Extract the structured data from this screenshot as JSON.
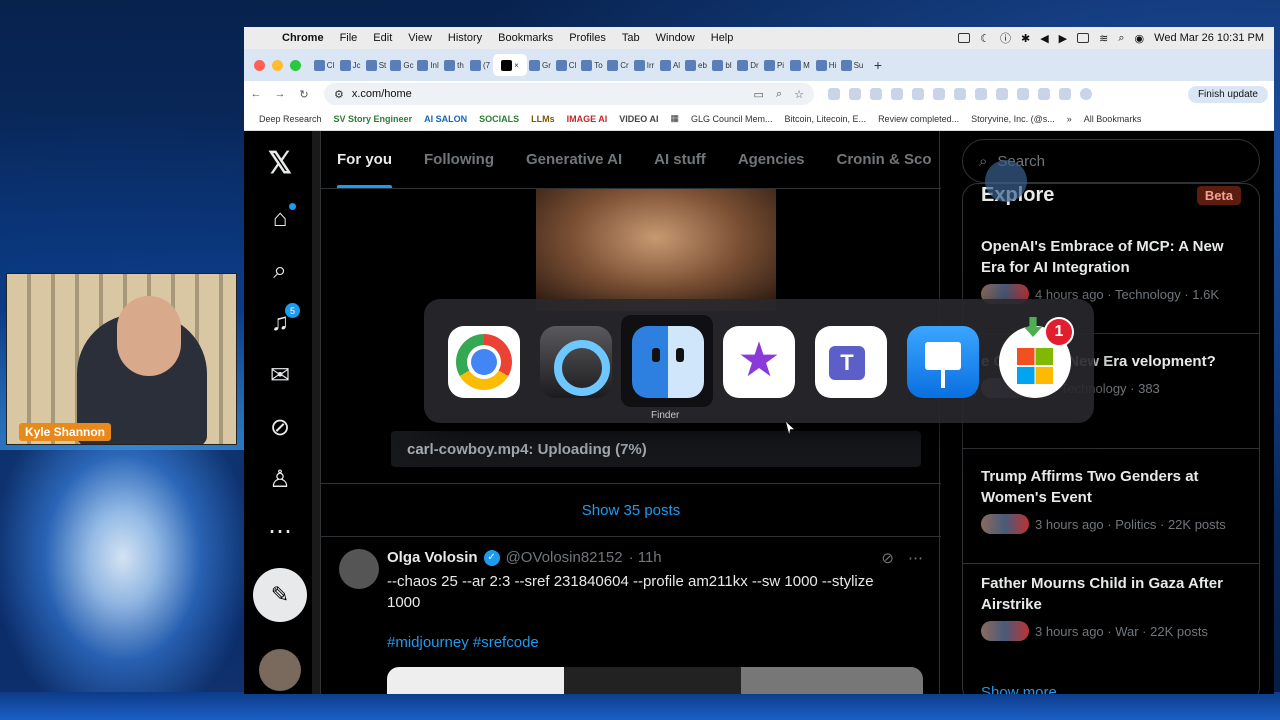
{
  "webcam": {
    "name": "Kyle Shannon"
  },
  "menubar": {
    "app": "Chrome",
    "items": [
      "File",
      "Edit",
      "View",
      "History",
      "Bookmarks",
      "Profiles",
      "Tab",
      "Window",
      "Help"
    ],
    "clock": "Wed Mar 26  10:31 PM"
  },
  "tabs": {
    "labels": [
      "Cl",
      "Jc",
      "St",
      "Gc",
      "Inl",
      "th",
      "(7",
      "",
      "Gr",
      "Cl",
      "To",
      "Cr",
      "Irr",
      "Al",
      "eb",
      "bl",
      "Dr",
      "Pi",
      "M",
      "Hi",
      "Su"
    ]
  },
  "toolbar": {
    "url": "x.com/home",
    "finish_update": "Finish update"
  },
  "bookmarks": [
    "Deep Research",
    "SV Story Engineer",
    "AI SALON",
    "SOCIALS",
    "LLMs",
    "IMAGE AI",
    "VIDEO AI",
    "GLG Council Mem...",
    "Bitcoin, Litecoin, E...",
    "Review completed...",
    "Storyvine, Inc. (@s...",
    "All Bookmarks"
  ],
  "bookmark_colors": {
    "SV Story Engineer": "#2e7d32",
    "AI SALON": "#1565c0",
    "SOCIALS": "#2e7d32",
    "LLMs": "#7b5a00",
    "IMAGE AI": "#c62828",
    "VIDEO AI": "#444"
  },
  "nav": {
    "notifications_count": "5"
  },
  "feed": {
    "tabs": [
      "For you",
      "Following",
      "Generative AI",
      "AI stuff",
      "Agencies",
      "Cronin & Sco"
    ],
    "upload_status": "carl-cowboy.mp4: Uploading (7%)",
    "show_posts": "Show 35 posts",
    "tweet": {
      "name": "Olga Volosin",
      "handle": "@OVolosin82152",
      "time": "· 11h",
      "text": "--chaos 25 --ar 2:3 --sref 231840604 --profile am211kx --sw 1000 --stylize 1000",
      "tags": "#midjourney #srefcode"
    }
  },
  "sidebar": {
    "search_placeholder": "Search",
    "explore_title": "Explore",
    "beta": "Beta",
    "stories": [
      {
        "headline": "OpenAI's Embrace of MCP: A New Era for AI Integration",
        "meta": "4 hours ago · Technology · 1.6K"
      },
      {
        "headline": "e Coding: A New Era velopment?",
        "meta": "go · Technology · 383"
      },
      {
        "headline": "Trump Affirms Two Genders at Women's Event",
        "meta": "3 hours ago · Politics · 22K posts"
      },
      {
        "headline": "Father Mourns Child in Gaza After Airstrike",
        "meta": "3 hours ago · War · 22K posts"
      }
    ],
    "show_more": "Show more"
  },
  "switcher": {
    "apps": [
      "chrome-icon",
      "quicktime-icon",
      "finder-icon",
      "imovie-icon",
      "teams-icon",
      "keynote-icon",
      "microsoft-store-icon"
    ],
    "selected_label": "Finder",
    "badge": "1"
  }
}
